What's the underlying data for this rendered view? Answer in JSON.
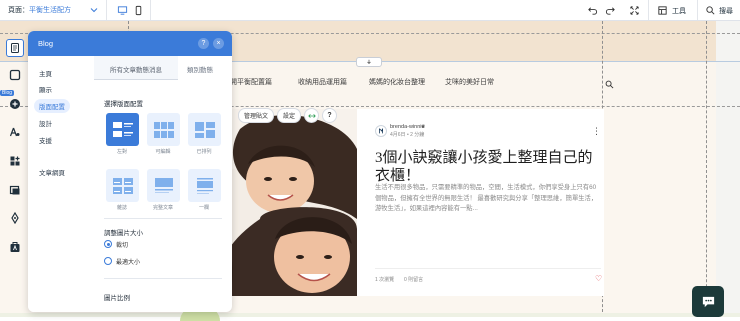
{
  "topbar": {
    "page_label": "頁面：",
    "page_value": "平衡生活配方",
    "tools_label": "工具",
    "search_label": "搜尋"
  },
  "site_nav": {
    "items": [
      "開平衡配置篇",
      "收納用品運用篇",
      "媽媽的化妝台整理",
      "艾咪的美好日常"
    ]
  },
  "post_toolbar": {
    "manage_label": "管理貼文",
    "settings_label": "設定",
    "help_label": "?"
  },
  "post": {
    "author": "brenda-winnie",
    "meta": "4月6日 • 2 分鐘",
    "title": "3個小訣竅讓小孩愛上整理自己的衣櫃！",
    "excerpt": "生活不用很多物品，只需要精準的物品，空間，生活模式，你們享受身上只有60個物品，但擁有全世界的無限生活！ 最喜歡研究與分享「整理思維，簡單生活，游牧生活」，如果這裡內容能有一點...",
    "views": "1 次瀏覽",
    "comments": "0 則留言"
  },
  "rail": {
    "badge": "Blog"
  },
  "panel": {
    "title": "Blog",
    "help": "?",
    "close": "×",
    "nav": [
      "主頁",
      "顯示",
      "版面配置",
      "設計",
      "支援",
      "文章網頁"
    ],
    "tabs": [
      "所有文章動態消息",
      "類別動態"
    ],
    "choose_layout": "選擇版面配置",
    "layouts": [
      "左對",
      "可編輯",
      "已排列",
      "雜誌",
      "完整文章",
      "一欄"
    ],
    "image_size_label": "調整圖片大小",
    "radio_options": [
      "裁切",
      "最適大小"
    ],
    "image_ratio_label": "圖片比例"
  },
  "colors": {
    "accent": "#3b7bd9",
    "header_band": "#f2e3d0",
    "chat": "#1c3a3a"
  }
}
